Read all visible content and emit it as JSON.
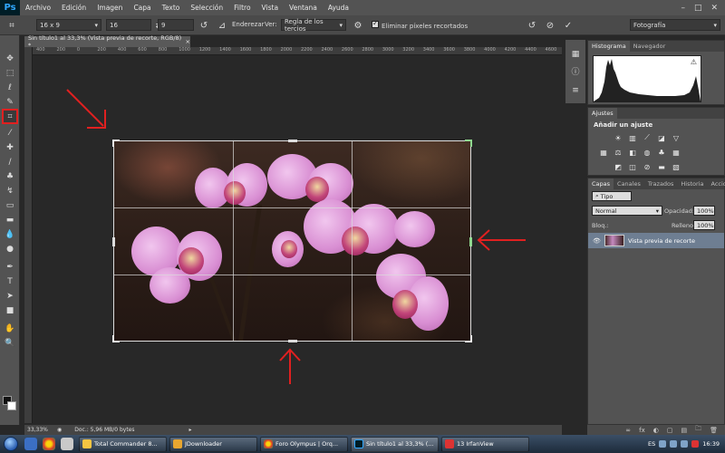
{
  "app": {
    "logo": "Ps"
  },
  "menu": [
    "Archivo",
    "Edición",
    "Imagen",
    "Capa",
    "Texto",
    "Selección",
    "Filtro",
    "Vista",
    "Ventana",
    "Ayuda"
  ],
  "window_controls": {
    "minimize": "–",
    "maximize": "□",
    "close": "✕"
  },
  "options": {
    "ratio_preset": "16 x 9",
    "width_value": "16",
    "height_value": "9",
    "straighten_label": "Enderezar",
    "view_label": "Ver:",
    "view_value": "Regla de los tercios",
    "delete_pixels_label": "Eliminar píxeles recortados",
    "workspace": "Fotografía",
    "swap_icon": "⇄",
    "reset_icon": "↺",
    "cancel_icon": "⊘",
    "commit_icon": "✓"
  },
  "document": {
    "tab_title": "Sin título1 al 33,3% (Vista previa de recorte, RGB/8) *",
    "tab_close": "×",
    "ruler_ticks": [
      "400",
      "200",
      "0",
      "200",
      "400",
      "600",
      "800",
      "1000",
      "1200",
      "1400",
      "1600",
      "1800",
      "2000",
      "2200",
      "2400",
      "2600",
      "2800",
      "3000",
      "3200",
      "3400",
      "3600",
      "3800",
      "4000",
      "4200",
      "4400",
      "4600"
    ],
    "zoom": "33,33%",
    "doc_info": "Doc.: 5,96 MB/0 bytes"
  },
  "panels": {
    "top_tabs": [
      "Histograma",
      "Navegador"
    ],
    "histogram_warning": "⚠",
    "adjust_tab": "Ajustes",
    "adjust_title": "Añadir un ajuste",
    "layer_tabs": [
      "Capas",
      "Canales",
      "Trazados",
      "Historia",
      "Acciones"
    ],
    "kind_label": "Tipo",
    "blend_mode": "Normal",
    "opacity_label": "Opacidad:",
    "opacity_value": "100%",
    "lock_label": "Bloq.:",
    "fill_label": "Relleno:",
    "fill_value": "100%",
    "layer_name": "Vista previa de recorte",
    "footer_icons": [
      "∞",
      "fx",
      "◐",
      "▢",
      "▤",
      "🗀",
      "🗑"
    ]
  },
  "taskbar": {
    "tasks": [
      "Total Commander 8...",
      "JDownloader",
      "Foro Olympus | Orq...",
      "Sin título1 al 33,3% (...",
      "13 IrfanView"
    ],
    "language": "ES",
    "clock": "16:39"
  },
  "colors": {
    "accent_red": "#e02020",
    "panel_bg": "#535353",
    "canvas_bg": "#282828",
    "layer_selected": "#6e7e92"
  }
}
